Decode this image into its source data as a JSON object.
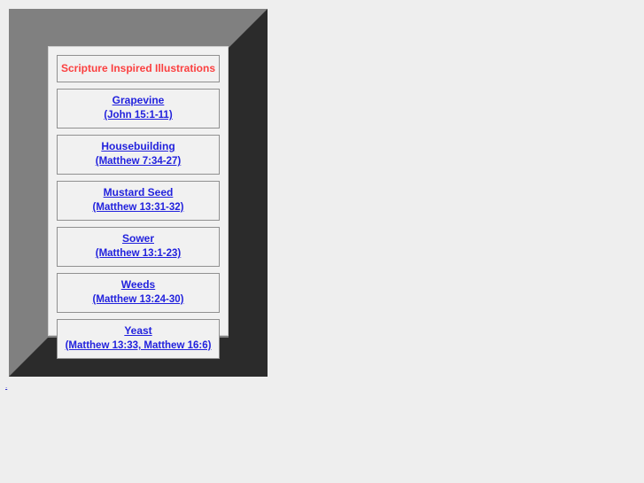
{
  "page": {
    "background_color": "#eeeeee",
    "frame": {
      "light_face_color": "#808080",
      "shadow_face_color": "#2b2b2b",
      "panel_background_color": "#f1f1f1"
    }
  },
  "panel": {
    "title": {
      "text": "Scripture Inspired Illustrations",
      "color": "#fb4040"
    },
    "link_color": "#2222dd",
    "items": [
      {
        "name": "Grapevine",
        "reference": "(John 15:1-11)"
      },
      {
        "name": "Housebuilding",
        "reference": "(Matthew 7:34-27)"
      },
      {
        "name": "Mustard Seed",
        "reference": "(Matthew 13:31-32)"
      },
      {
        "name": "Sower",
        "reference": "(Matthew 13:1-23)"
      },
      {
        "name": "Weeds",
        "reference": "(Matthew 13:24-30)"
      },
      {
        "name": "Yeast",
        "reference": "(Matthew 13:33, Matthew 16:6)"
      }
    ]
  },
  "stray_anchor": {
    "label": "."
  }
}
